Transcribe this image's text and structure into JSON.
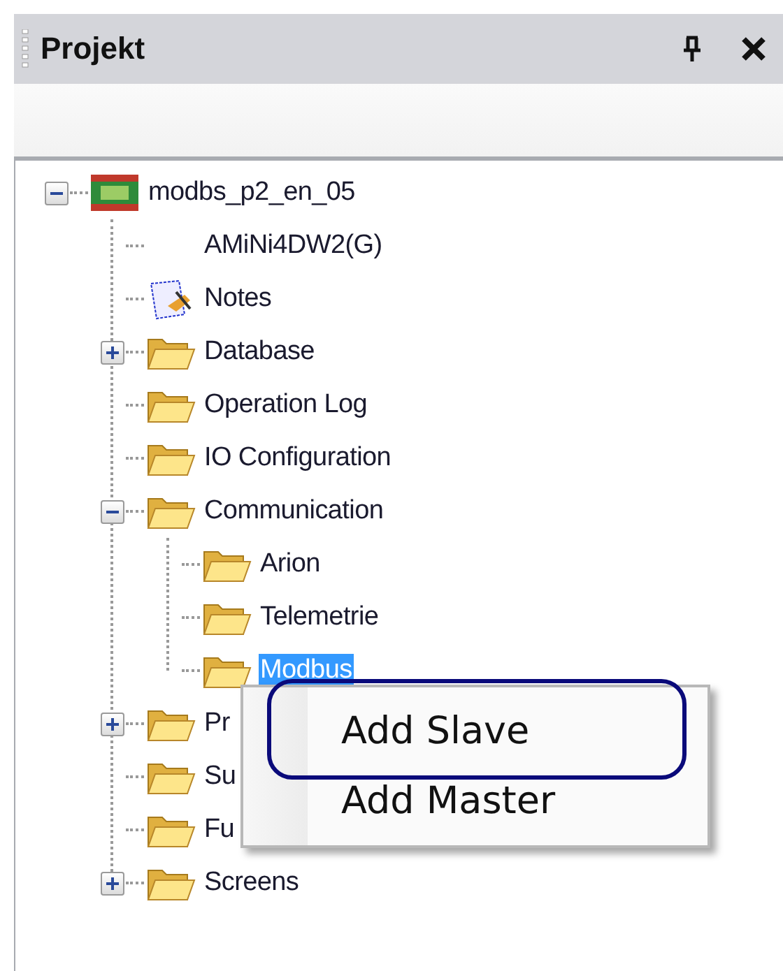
{
  "panel": {
    "title": "Projekt"
  },
  "tree": [
    {
      "label": "modbs_p2_en_05",
      "kind": "device",
      "expanded": true,
      "selected": false,
      "children": [
        {
          "label": "AMiNi4DW2(G)",
          "kind": "blank",
          "selected": false
        },
        {
          "label": "Notes",
          "kind": "notes",
          "selected": false
        },
        {
          "label": "Database",
          "kind": "folder",
          "expanded": false,
          "selected": false
        },
        {
          "label": "Operation Log",
          "kind": "folder",
          "selected": false
        },
        {
          "label": "IO Configuration",
          "kind": "folder",
          "selected": false
        },
        {
          "label": "Communication",
          "kind": "folder",
          "expanded": true,
          "selected": false,
          "children": [
            {
              "label": "Arion",
              "kind": "folder",
              "selected": false
            },
            {
              "label": "Telemetrie",
              "kind": "folder",
              "selected": false
            },
            {
              "label": "Modbus",
              "kind": "folder",
              "selected": true
            }
          ]
        },
        {
          "label": "Pr",
          "kind": "folder",
          "expanded": false,
          "selected": false
        },
        {
          "label": "Su",
          "kind": "folder",
          "selected": false
        },
        {
          "label": "Fu",
          "kind": "folder",
          "selected": false
        },
        {
          "label": "Screens",
          "kind": "folder",
          "expanded": false,
          "selected": false
        }
      ]
    }
  ],
  "context_menu": {
    "items": [
      {
        "label": "Add Slave",
        "highlighted": true
      },
      {
        "label": "Add Master",
        "highlighted": false
      }
    ]
  }
}
